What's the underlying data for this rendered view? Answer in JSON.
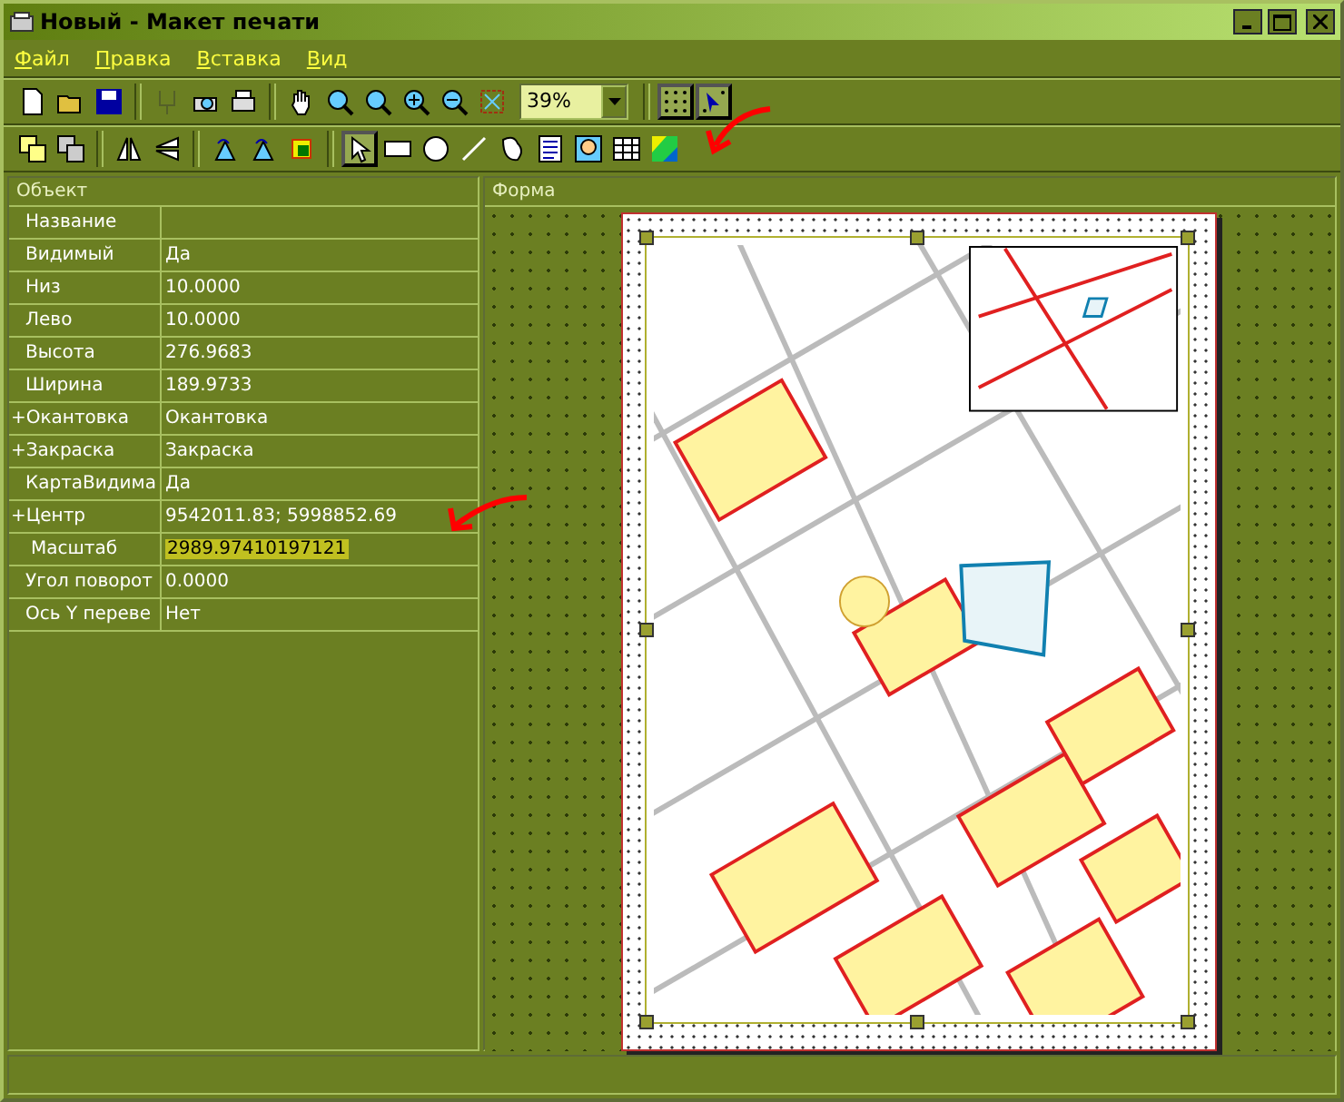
{
  "window": {
    "title": "Новый - Макет печати"
  },
  "menu": [
    {
      "label": "Файл"
    },
    {
      "label": "Правка"
    },
    {
      "label": "Вставка"
    },
    {
      "label": "Вид"
    }
  ],
  "toolbar_top": [
    {
      "kind": "icon",
      "pressed": false,
      "disabled": false
    },
    {
      "kind": "icon",
      "pressed": false,
      "disabled": false
    },
    {
      "kind": "icon",
      "pressed": false,
      "disabled": false
    },
    {
      "kind": "sep"
    },
    {
      "kind": "icon",
      "pressed": false,
      "disabled": true
    },
    {
      "kind": "icon",
      "pressed": false,
      "disabled": false
    },
    {
      "kind": "icon",
      "pressed": false,
      "disabled": false
    },
    {
      "kind": "sep"
    },
    {
      "kind": "icon",
      "pressed": false,
      "disabled": false
    },
    {
      "kind": "icon",
      "pressed": false,
      "disabled": false
    },
    {
      "kind": "icon",
      "pressed": false,
      "disabled": false
    },
    {
      "kind": "icon",
      "pressed": false,
      "disabled": false
    },
    {
      "kind": "icon",
      "pressed": false,
      "disabled": false
    },
    {
      "kind": "icon",
      "pressed": false,
      "disabled": false
    },
    {
      "kind": "combo",
      "value": "39%"
    },
    {
      "kind": "sep"
    },
    {
      "kind": "icon",
      "pressed": true,
      "disabled": false
    },
    {
      "kind": "icon",
      "pressed": true,
      "disabled": false
    }
  ],
  "toolbar_bottom": [
    {
      "kind": "icon",
      "pressed": false,
      "disabled": false
    },
    {
      "kind": "icon",
      "pressed": false,
      "disabled": false
    },
    {
      "kind": "sep"
    },
    {
      "kind": "icon",
      "pressed": false,
      "disabled": false
    },
    {
      "kind": "icon",
      "pressed": false,
      "disabled": false
    },
    {
      "kind": "sep"
    },
    {
      "kind": "icon",
      "pressed": false,
      "disabled": false
    },
    {
      "kind": "icon",
      "pressed": false,
      "disabled": false
    },
    {
      "kind": "icon",
      "pressed": false,
      "disabled": false
    },
    {
      "kind": "sep"
    },
    {
      "kind": "icon",
      "pressed": true,
      "disabled": false
    },
    {
      "kind": "icon",
      "pressed": false,
      "disabled": false
    },
    {
      "kind": "icon",
      "pressed": false,
      "disabled": false
    },
    {
      "kind": "icon",
      "pressed": false,
      "disabled": false
    },
    {
      "kind": "icon",
      "pressed": false,
      "disabled": false
    },
    {
      "kind": "icon",
      "pressed": false,
      "disabled": false
    },
    {
      "kind": "icon",
      "pressed": false,
      "disabled": false
    },
    {
      "kind": "icon",
      "pressed": false,
      "disabled": false
    },
    {
      "kind": "icon",
      "pressed": false,
      "disabled": false
    }
  ],
  "properties": {
    "title": "Объект",
    "rows": [
      {
        "name": "Название",
        "value": "",
        "selected": false
      },
      {
        "name": "Видимый",
        "value": "Да",
        "selected": false
      },
      {
        "name": "Низ",
        "value": "10.0000",
        "selected": false
      },
      {
        "name": "Лево",
        "value": "10.0000",
        "selected": false
      },
      {
        "name": "Высота",
        "value": "276.9683",
        "selected": false
      },
      {
        "name": "Ширина",
        "value": "189.9733",
        "selected": false
      },
      {
        "name": "+Окантовка",
        "value": "Окантовка",
        "selected": false
      },
      {
        "name": "+Закраска",
        "value": "Закраска",
        "selected": false
      },
      {
        "name": "КартаВидима",
        "value": "Да",
        "selected": false
      },
      {
        "name": "+Центр",
        "value": "9542011.83; 5998852.69",
        "selected": false
      },
      {
        "name": "Масштаб",
        "value": "2989.97410197121",
        "selected": true
      },
      {
        "name": "Угол поворот",
        "value": "0.0000",
        "selected": false
      },
      {
        "name": "Ось Y переве",
        "value": "Нет",
        "selected": false
      }
    ]
  },
  "form": {
    "title": "Форма"
  }
}
